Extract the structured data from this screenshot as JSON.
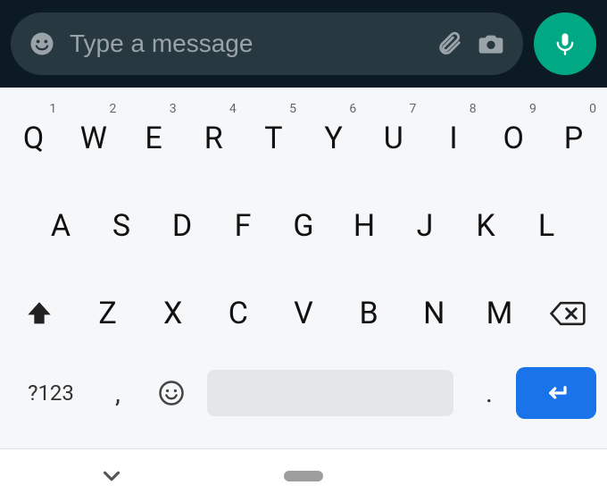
{
  "input": {
    "placeholder": "Type a message"
  },
  "keyboard": {
    "row1": [
      {
        "letter": "Q",
        "hint": "1"
      },
      {
        "letter": "W",
        "hint": "2"
      },
      {
        "letter": "E",
        "hint": "3"
      },
      {
        "letter": "R",
        "hint": "4"
      },
      {
        "letter": "T",
        "hint": "5"
      },
      {
        "letter": "Y",
        "hint": "6"
      },
      {
        "letter": "U",
        "hint": "7"
      },
      {
        "letter": "I",
        "hint": "8"
      },
      {
        "letter": "O",
        "hint": "9"
      },
      {
        "letter": "P",
        "hint": "0"
      }
    ],
    "row2": [
      {
        "letter": "A"
      },
      {
        "letter": "S"
      },
      {
        "letter": "D"
      },
      {
        "letter": "F"
      },
      {
        "letter": "G"
      },
      {
        "letter": "H"
      },
      {
        "letter": "J"
      },
      {
        "letter": "K"
      },
      {
        "letter": "L"
      }
    ],
    "row3": [
      {
        "letter": "Z"
      },
      {
        "letter": "X"
      },
      {
        "letter": "C"
      },
      {
        "letter": "V"
      },
      {
        "letter": "B"
      },
      {
        "letter": "N"
      },
      {
        "letter": "M"
      }
    ],
    "symbols_label": "?123",
    "comma": ",",
    "period": "."
  }
}
